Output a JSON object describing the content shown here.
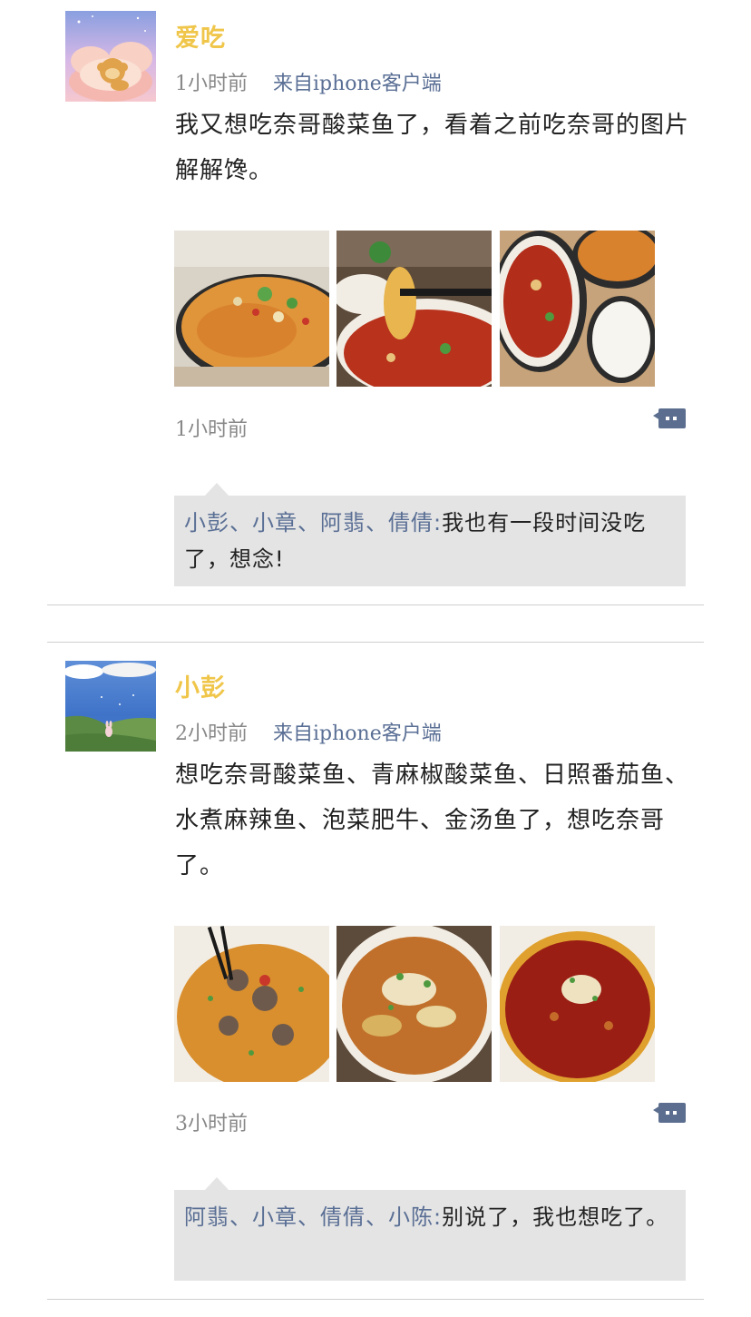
{
  "posts": [
    {
      "username": "爱吃",
      "time": "1小时前",
      "source": "来自iphone客户端",
      "text": "我又想吃奈哥酸菜鱼了，看着之前吃奈哥的图片解解馋。",
      "timestamp": "1小时前",
      "comment": {
        "names": "小彭、小章、阿翡、倩倩:",
        "text": "我也有一段时间没吃了，想念!"
      }
    },
    {
      "username": "小彭",
      "time": "2小时前",
      "source": "来自iphone客户端",
      "text": "想吃奈哥酸菜鱼、青麻椒酸菜鱼、日照番茄鱼、水煮麻辣鱼、泡菜肥牛、金汤鱼了，想吃奈哥了。",
      "timestamp": "3小时前",
      "comment": {
        "names": "阿翡、小章、倩倩、小陈:",
        "text": "别说了，我也想吃了。"
      }
    }
  ],
  "colors": {
    "username": "#f0c64a",
    "link": "#5a6f95",
    "comment_bg": "#e4e4e4",
    "meta": "#888888"
  },
  "icons": {
    "comment": "comment-bubble-icon"
  }
}
